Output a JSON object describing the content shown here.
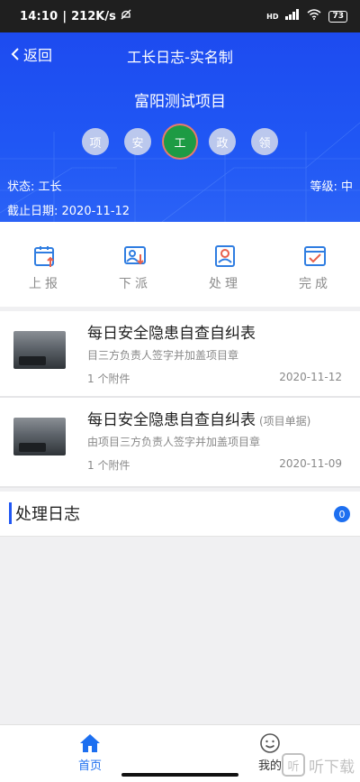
{
  "status_bar": {
    "time": "14:10",
    "net_speed": "212K/s",
    "signal": "HD",
    "battery": "73"
  },
  "header": {
    "back_label": "返回",
    "title": "工长日志-实名制",
    "project": "富阳测试项目",
    "roles": [
      "项",
      "安",
      "工",
      "政",
      "领"
    ],
    "active_role_index": 2,
    "status": "状态: 工长",
    "level": "等级: 中",
    "deadline": "截止日期: 2020-11-12",
    "bg_color": "#1f55f3"
  },
  "actions": [
    {
      "label": "上报",
      "icon": "report-upload-icon"
    },
    {
      "label": "下派",
      "icon": "dispatch-icon"
    },
    {
      "label": "处理",
      "icon": "handle-user-icon"
    },
    {
      "label": "完成",
      "icon": "complete-check-icon"
    }
  ],
  "items": [
    {
      "title": "每日安全隐患自查自纠表",
      "tag": "",
      "desc": "目三方负责人签字并加盖项目章",
      "attachments": "1 个附件",
      "date": "2020-11-12"
    },
    {
      "title": "每日安全隐患自查自纠表",
      "tag": "(项目单据)",
      "desc": "由项目三方负责人签字并加盖项目章",
      "attachments": "1 个附件",
      "date": "2020-11-09"
    }
  ],
  "log": {
    "title": "处理日志",
    "count": "0"
  },
  "tabbar": [
    {
      "label": "首页",
      "icon": "home-icon",
      "active": true
    },
    {
      "label": "我的",
      "icon": "profile-smile-icon",
      "active": false
    }
  ],
  "watermark": {
    "text": "听下载",
    "box": "听"
  },
  "colors": {
    "accent": "#1d6ff0",
    "active_role": "#1d9b44"
  }
}
